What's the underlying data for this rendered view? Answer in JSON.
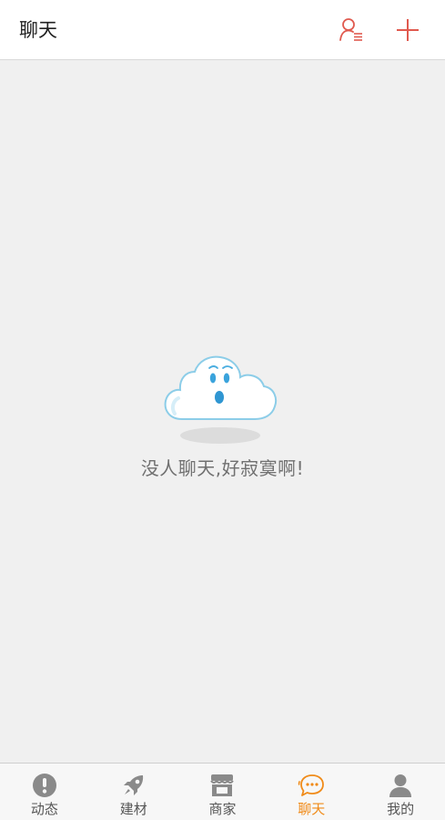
{
  "header": {
    "title": "聊天",
    "contacts_icon": "contacts-list-icon",
    "add_icon": "plus-icon",
    "accent_color": "#e05a4f"
  },
  "empty_state": {
    "message": "没人聊天,好寂寞啊!",
    "illustration": "cloud-face-icon"
  },
  "tabbar": {
    "active_color": "#f08b19",
    "inactive_color": "#8a8a8a",
    "tabs": [
      {
        "label": "动态",
        "icon": "exclamation-circle-icon",
        "active": false
      },
      {
        "label": "建材",
        "icon": "rocket-icon",
        "active": false
      },
      {
        "label": "商家",
        "icon": "store-icon",
        "active": false
      },
      {
        "label": "聊天",
        "icon": "chat-bubble-icon",
        "active": true
      },
      {
        "label": "我的",
        "icon": "person-icon",
        "active": false
      }
    ]
  }
}
